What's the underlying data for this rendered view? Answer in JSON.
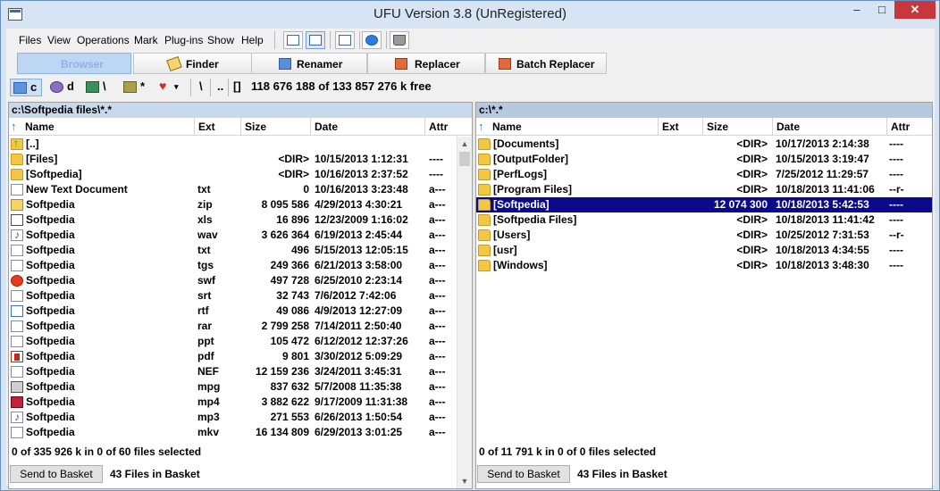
{
  "window": {
    "title": "UFU Version 3.8 (UnRegistered)",
    "controls": {
      "minimize": "–",
      "maximize": "□",
      "close": "✕"
    }
  },
  "menu": {
    "items": [
      {
        "label": "Files"
      },
      {
        "label": "View"
      },
      {
        "label": "Operations"
      },
      {
        "label": "Mark"
      },
      {
        "label": "Plug-ins"
      },
      {
        "label": "Show"
      },
      {
        "label": "Help"
      }
    ],
    "icon_buttons": [
      {
        "icon": "panel-layout-icon"
      },
      {
        "icon": "dual-panel-icon"
      },
      {
        "icon": "checklist-icon"
      },
      {
        "icon": "globe-icon"
      },
      {
        "icon": "recycle-bin-icon"
      }
    ]
  },
  "modes": [
    {
      "label": "Browser",
      "icon": "browser-icon",
      "active": true
    },
    {
      "label": "Finder",
      "icon": "finder-icon",
      "active": false
    },
    {
      "label": "Renamer",
      "icon": "renamer-icon",
      "active": false
    },
    {
      "label": "Replacer",
      "icon": "replacer-icon",
      "active": false
    },
    {
      "label": "Batch Replacer",
      "icon": "batch-replacer-icon",
      "active": false
    }
  ],
  "drives": {
    "items": [
      {
        "label": "c",
        "icon": "hard-drive-icon",
        "active": true
      },
      {
        "label": "d",
        "icon": "dvd-drive-icon",
        "active": false
      },
      {
        "label": "\\",
        "icon": "network-drive-icon",
        "active": false
      },
      {
        "label": "*",
        "icon": "package-icon",
        "active": false
      },
      {
        "label": "",
        "icon": "favorites-heart-icon",
        "active": false
      }
    ],
    "root_label": "\\",
    "parent_label": "..",
    "bracket_label": "[]",
    "free_space": "118 676 188 of 133 857 276 k free"
  },
  "left_pane": {
    "path": "c:\\Softpedia files\\*.*",
    "columns": [
      "Name",
      "Ext",
      "Size",
      "Date",
      "Attr"
    ],
    "rows": [
      {
        "icon": "up",
        "name": "[..]",
        "ext": "",
        "size": "",
        "date": "",
        "attr": ""
      },
      {
        "icon": "folder",
        "name": "[Files]",
        "ext": "",
        "size": "<DIR>",
        "date": "10/15/2013 1:12:31",
        "attr": "----"
      },
      {
        "icon": "folder",
        "name": "[Softpedia]",
        "ext": "",
        "size": "<DIR>",
        "date": "10/16/2013 2:37:52",
        "attr": "----"
      },
      {
        "icon": "doc",
        "name": "New Text Document",
        "ext": "txt",
        "size": "0",
        "date": "10/16/2013 3:23:48",
        "attr": "a---"
      },
      {
        "icon": "zip",
        "name": "Softpedia",
        "ext": "zip",
        "size": "8 095 586",
        "date": "4/29/2013 4:30:21",
        "attr": "a---"
      },
      {
        "icon": "xls",
        "name": "Softpedia",
        "ext": "xls",
        "size": "16 896",
        "date": "12/23/2009 1:16:02",
        "attr": "a---"
      },
      {
        "icon": "wav",
        "name": "Softpedia",
        "ext": "wav",
        "size": "3 626 364",
        "date": "6/19/2013 2:45:44",
        "attr": "a---"
      },
      {
        "icon": "doc",
        "name": "Softpedia",
        "ext": "txt",
        "size": "496",
        "date": "5/15/2013 12:05:15",
        "attr": "a---"
      },
      {
        "icon": "doc",
        "name": "Softpedia",
        "ext": "tgs",
        "size": "249 366",
        "date": "6/21/2013 3:58:00",
        "attr": "a---"
      },
      {
        "icon": "swf",
        "name": "Softpedia",
        "ext": "swf",
        "size": "497 728",
        "date": "6/25/2010 2:23:14",
        "attr": "a---"
      },
      {
        "icon": "doc",
        "name": "Softpedia",
        "ext": "srt",
        "size": "32 743",
        "date": "7/6/2012 7:42:06",
        "attr": "a---"
      },
      {
        "icon": "rtf",
        "name": "Softpedia",
        "ext": "rtf",
        "size": "49 086",
        "date": "4/9/2013 12:27:09",
        "attr": "a---"
      },
      {
        "icon": "doc",
        "name": "Softpedia",
        "ext": "rar",
        "size": "2 799 258",
        "date": "7/14/2011 2:50:40",
        "attr": "a---"
      },
      {
        "icon": "doc",
        "name": "Softpedia",
        "ext": "ppt",
        "size": "105 472",
        "date": "6/12/2012 12:37:26",
        "attr": "a---"
      },
      {
        "icon": "pdf",
        "name": "Softpedia",
        "ext": "pdf",
        "size": "9 801",
        "date": "3/30/2012 5:09:29",
        "attr": "a---"
      },
      {
        "icon": "nef",
        "name": "Softpedia",
        "ext": "NEF",
        "size": "12 159 236",
        "date": "3/24/2011 3:45:31",
        "attr": "a---"
      },
      {
        "icon": "mpg",
        "name": "Softpedia",
        "ext": "mpg",
        "size": "837 632",
        "date": "5/7/2008 11:35:38",
        "attr": "a---"
      },
      {
        "icon": "mp4",
        "name": "Softpedia",
        "ext": "mp4",
        "size": "3 882 622",
        "date": "9/17/2009 11:31:38",
        "attr": "a---"
      },
      {
        "icon": "mp3",
        "name": "Softpedia",
        "ext": "mp3",
        "size": "271 553",
        "date": "6/26/2013 1:50:54",
        "attr": "a---"
      },
      {
        "icon": "doc",
        "name": "Softpedia",
        "ext": "mkv",
        "size": "16 134 809",
        "date": "6/29/2013 3:01:25",
        "attr": "a---"
      }
    ],
    "status": "0 of 335 926 k in 0 of 60 files selected",
    "basket_button": "Send to Basket",
    "basket_count": "43 Files in Basket"
  },
  "right_pane": {
    "path": "c:\\*.*",
    "columns": [
      "Name",
      "Ext",
      "Size",
      "Date",
      "Attr"
    ],
    "rows": [
      {
        "icon": "folder",
        "name": "[Documents]",
        "ext": "",
        "size": "<DIR>",
        "date": "10/17/2013 2:14:38",
        "attr": "----",
        "selected": false
      },
      {
        "icon": "folder",
        "name": "[OutputFolder]",
        "ext": "",
        "size": "<DIR>",
        "date": "10/15/2013 3:19:47",
        "attr": "----",
        "selected": false
      },
      {
        "icon": "folder",
        "name": "[PerfLogs]",
        "ext": "",
        "size": "<DIR>",
        "date": "7/25/2012 11:29:57",
        "attr": "----",
        "selected": false
      },
      {
        "icon": "folder",
        "name": "[Program Files]",
        "ext": "",
        "size": "<DIR>",
        "date": "10/18/2013 11:41:06",
        "attr": "--r-",
        "selected": false
      },
      {
        "icon": "folder",
        "name": "[Softpedia]",
        "ext": "",
        "size": "12 074 300",
        "date": "10/18/2013 5:42:53",
        "attr": "----",
        "selected": true
      },
      {
        "icon": "folder",
        "name": "[Softpedia Files]",
        "ext": "",
        "size": "<DIR>",
        "date": "10/18/2013 11:41:42",
        "attr": "----",
        "selected": false
      },
      {
        "icon": "folder",
        "name": "[Users]",
        "ext": "",
        "size": "<DIR>",
        "date": "10/25/2012 7:31:53",
        "attr": "--r-",
        "selected": false
      },
      {
        "icon": "folder",
        "name": "[usr]",
        "ext": "",
        "size": "<DIR>",
        "date": "10/18/2013 4:34:55",
        "attr": "----",
        "selected": false
      },
      {
        "icon": "folder",
        "name": "[Windows]",
        "ext": "",
        "size": "<DIR>",
        "date": "10/18/2013 3:48:30",
        "attr": "----",
        "selected": false
      }
    ],
    "status": "0 of 11 791 k in 0 of 0 files selected",
    "basket_button": "Send to Basket",
    "basket_count": "43 Files in Basket"
  },
  "colors": {
    "selection": "#0a0a8a",
    "titlebar": "#d7e4f3",
    "close_button": "#c7373c",
    "folder": "#f3c744"
  }
}
